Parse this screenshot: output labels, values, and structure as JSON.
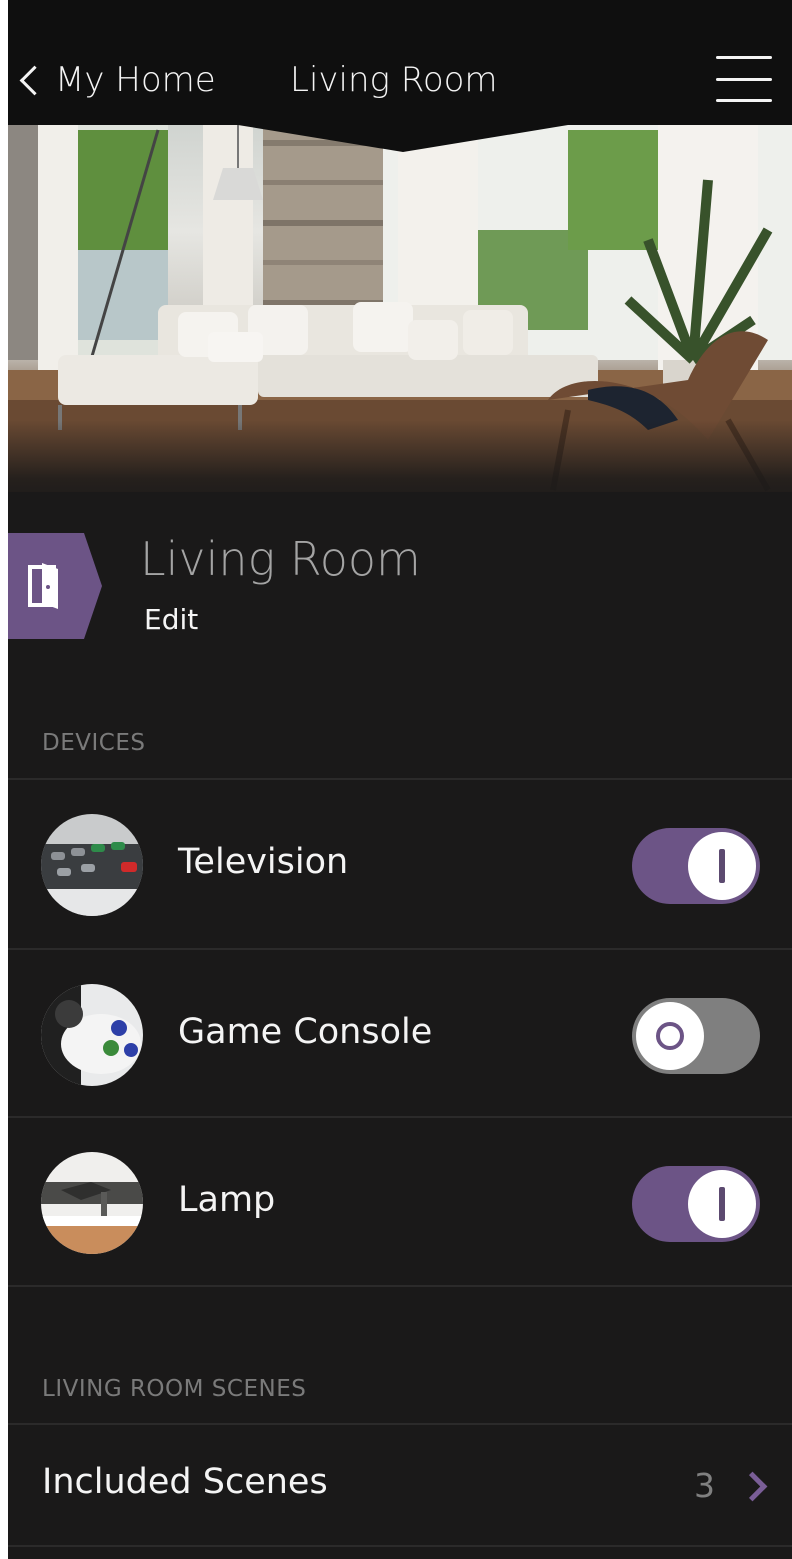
{
  "header": {
    "back_label": "My Home",
    "title": "Living Room",
    "menu_icon": "hamburger-menu-icon"
  },
  "room": {
    "name": "Living Room",
    "edit_label": "Edit",
    "icon": "door-icon",
    "accent_color": "#6c5486"
  },
  "devices_section": {
    "label": "DEVICES",
    "items": [
      {
        "label": "Television",
        "icon": "remote-control-thumbnail",
        "on": true
      },
      {
        "label": "Game Console",
        "icon": "game-controller-thumbnail",
        "on": false
      },
      {
        "label": "Lamp",
        "icon": "lamp-thumbnail",
        "on": true
      }
    ]
  },
  "scenes_section": {
    "label": "LIVING ROOM SCENES",
    "row_label": "Included Scenes",
    "count": "3"
  },
  "colors": {
    "background": "#1a1919",
    "header": "#0f0f0f",
    "toggle_on": "#6c5486",
    "toggle_off": "#7f7f7f"
  }
}
